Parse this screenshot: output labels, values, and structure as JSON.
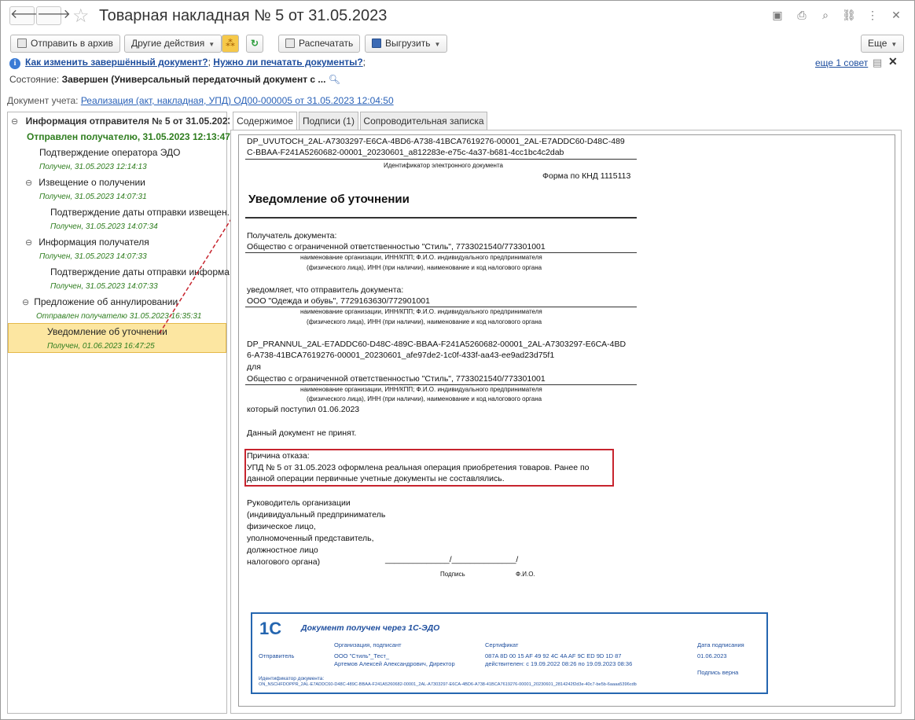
{
  "window": {
    "title": "Товарная накладная № 5 от 31.05.2023",
    "back": "🡐",
    "forward": "🡒"
  },
  "toolbar": {
    "archive": "Отправить в архив",
    "other": "Другие действия",
    "print": "Распечатать",
    "export": "Выгрузить",
    "more": "Еще"
  },
  "hints": {
    "link1": "Как изменить завершённый документ?",
    "link2": "Нужно ли печатать документы?",
    "semi": ";",
    "more_tip": "еще 1 совет"
  },
  "state": {
    "label": "Состояние:",
    "value": "Завершен (Универсальный передаточный документ с ..."
  },
  "account": {
    "label": "Документ учета:",
    "value": "Реализация (акт, накладная, УПД) ОД00-000005 от 31.05.2023 12:04:50"
  },
  "tree": {
    "root": "Информация отправителя № 5 от 31.05.2023",
    "sent": "Отправлен получателю, 31.05.2023 12:13:47",
    "items": [
      {
        "label": "Подтверждение оператора ЭДО",
        "sub": "Получен, 31.05.2023 12:14:13"
      },
      {
        "label": "Извещение о получении",
        "sub": "Получен, 31.05.2023 14:07:31"
      },
      {
        "label": "Подтверждение даты отправки извещен...",
        "sub": "Получен, 31.05.2023 14:07:34"
      },
      {
        "label": "Информация получателя",
        "sub": "Получен, 31.05.2023 14:07:33"
      },
      {
        "label": "Подтверждение даты отправки информа...",
        "sub": "Получен, 31.05.2023 14:07:33"
      },
      {
        "label": "Предложение об аннулировании",
        "sub": "Отправлен получателю 31.05.2023 16:35:31"
      },
      {
        "label": "Уведомление об уточнении",
        "sub": "Получен, 01.06.2023 16:47:25"
      }
    ]
  },
  "tabs": [
    "Содержимое",
    "Подписи (1)",
    "Сопроводительная записка"
  ],
  "doc": {
    "id1": "DP_UVUTOCH_2AL-A7303297-E6CA-4BD6-A738-41BCA7619276-00001_2AL-E7ADDC60-D48C-489",
    "id2": "C-BBAA-F241A5260682-00001_20230601_a812283e-e75c-4a37-b681-4cc1bc4c2dab",
    "id_caption": "Идентификатор электронного документа",
    "knd": "Форма по КНД 1115113",
    "heading": "Уведомление об уточнении",
    "recipient_label": "Получатель документа:",
    "recipient": "Общество с ограниченной ответственностью \"Стиль\", 7733021540/773301001",
    "cap1": "наименование организации, ИНН/КПП; Ф.И.О. индивидуального предпринимателя",
    "cap2": "(физического лица), ИНН (при наличии), наименование и код налогового органа",
    "notify_label": "уведомляет, что отправитель документа:",
    "sender": "ООО \"Одежда и обувь\", 7729163630/772901001",
    "ref1": "DP_PRANNUL_2AL-E7ADDC60-D48C-489C-BBAA-F241A5260682-00001_2AL-A7303297-E6CA-4BD",
    "ref2": "6-A738-41BCA7619276-00001_20230601_afe97de2-1c0f-433f-aa43-ee9ad23d75f1",
    "for": "для",
    "recipient2": "Общество с ограниченной ответственностью \"Стиль\", 7733021540/773301001",
    "received": "который поступил 01.06.2023",
    "not_accepted": "Данный документ не принят.",
    "reason_label": "Причина отказа:",
    "reason1": "УПД № 5 от 31.05.2023 оформлена реальная операция приобретения товаров. Ранее по",
    "reason2": "данной операции первичные учетные документы не составлялись.",
    "sign": [
      "Руководитель  организации",
      "(индивидуальный предприниматель",
      "физическое лицо,",
      "уполномоченный представитель,",
      "должностное лицо",
      "налогового органа)"
    ],
    "sign_line": "______________/______________/",
    "sign_cap": "Подпись",
    "fio_cap": "Ф.И.О."
  },
  "edo": {
    "logo": "1С",
    "title": "Документ получен через 1С-ЭДО",
    "col_org": "Организация, подписант",
    "col_cert": "Сертификат",
    "col_date": "Дата подписания",
    "sender": "Отправитель",
    "org": "ООО \"Стиль\"_Тест_",
    "person": "Артемов Алексей Александрович, Директор",
    "cert": "087A 8D 00 15 AF 49 92 4C 4A AF 9C ED 9D 1D 87",
    "valid": "действителен: с 19.09.2022 08:26 по 19.09.2023 08:36",
    "date": "01.06.2023",
    "verify": "Подпись верна",
    "doc_id_label": "Идентификатор документа:",
    "doc_id": "ON_NSCHFDOPPR_2AL-E7ADDC60-D48C-489C-BBAA-F241A5260682-00001_2AL-A7303297-E6CA-4BD6-A738-41BCA7619276-00001_20230601_2814242f2d3e-40c7-be5b-6aaaa5396cdb"
  }
}
